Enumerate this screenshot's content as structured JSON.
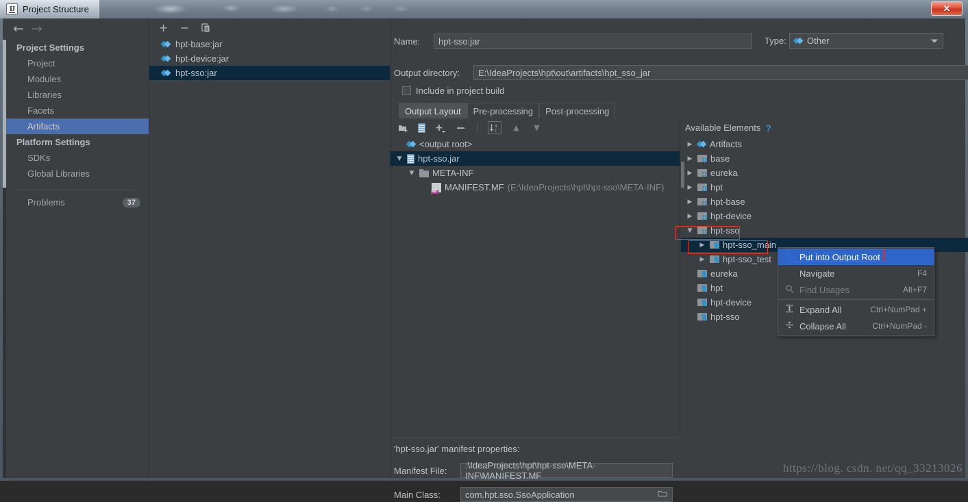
{
  "window": {
    "title": "Project Structure",
    "app_icon": "intellij-idea-icon",
    "close_label": "✕",
    "watermark": "https://blog. csdn. net/qq_33213026"
  },
  "sidebar": {
    "nav_back": "←",
    "nav_forward": "→",
    "groups": [
      {
        "header": "Project Settings",
        "items": [
          {
            "label": "Project",
            "selected": false
          },
          {
            "label": "Modules",
            "selected": false
          },
          {
            "label": "Libraries",
            "selected": false
          },
          {
            "label": "Facets",
            "selected": false
          },
          {
            "label": "Artifacts",
            "selected": true
          }
        ]
      },
      {
        "header": "Platform Settings",
        "items": [
          {
            "label": "SDKs",
            "selected": false
          },
          {
            "label": "Global Libraries",
            "selected": false
          }
        ]
      }
    ],
    "problems": {
      "label": "Problems",
      "count": "37"
    }
  },
  "artifact_list": {
    "toolbar": {
      "add": "+",
      "remove": "−",
      "copy": "copy-icon"
    },
    "items": [
      {
        "label": "hpt-base:jar",
        "selected": false
      },
      {
        "label": "hpt-device:jar",
        "selected": false
      },
      {
        "label": "hpt-sso:jar",
        "selected": true
      }
    ]
  },
  "main": {
    "name_label": "Name:",
    "name_value": "hpt-sso:jar",
    "type_label": "Type:",
    "type_value": "Other",
    "output_dir_label": "Output directory:",
    "output_dir_value": "E:\\IdeaProjects\\hpt\\out\\artifacts\\hpt_sso_jar",
    "include_build_label": "Include in project build",
    "include_build_checked": false,
    "tabs": [
      {
        "label": "Output Layout",
        "active": true
      },
      {
        "label": "Pre-processing",
        "active": false
      },
      {
        "label": "Post-processing",
        "active": false
      }
    ]
  },
  "layout_tree": {
    "toolbar": {
      "add_dir": "add-directory-icon",
      "add_archive": "add-archive-icon",
      "add": "+",
      "remove": "−",
      "sort": "sort-az-icon",
      "move_up": "▲",
      "move_down": "▼"
    },
    "rows": [
      {
        "indent": 0,
        "twisty": "",
        "icon": "output-root-icon",
        "label": "<output root>",
        "sub": "",
        "selected": false
      },
      {
        "indent": 0,
        "twisty": "▼",
        "icon": "archive-icon",
        "label": "hpt-sso.jar",
        "sub": "",
        "selected": true
      },
      {
        "indent": 1,
        "twisty": "▼",
        "icon": "folder-icon",
        "label": "META-INF",
        "sub": "",
        "selected": false
      },
      {
        "indent": 2,
        "twisty": "",
        "icon": "manifest-icon",
        "label": "MANIFEST.MF",
        "sub": "(E:\\IdeaProjects\\hpt\\hpt-sso\\META-INF)",
        "selected": false
      }
    ]
  },
  "available_elements": {
    "header": "Available Elements",
    "help": "?",
    "rows": [
      {
        "indent": 0,
        "twisty": "▶",
        "icon": "artifacts-icon",
        "label": "Artifacts",
        "state": "none"
      },
      {
        "indent": 0,
        "twisty": "▶",
        "icon": "module-icon",
        "label": "base",
        "state": "none"
      },
      {
        "indent": 0,
        "twisty": "▶",
        "icon": "module-icon",
        "label": "eureka",
        "state": "none"
      },
      {
        "indent": 0,
        "twisty": "▶",
        "icon": "module-icon",
        "label": "hpt",
        "state": "none"
      },
      {
        "indent": 0,
        "twisty": "▶",
        "icon": "module-icon",
        "label": "hpt-base",
        "state": "none"
      },
      {
        "indent": 0,
        "twisty": "▶",
        "icon": "module-icon",
        "label": "hpt-device",
        "state": "none"
      },
      {
        "indent": 0,
        "twisty": "▼",
        "icon": "module-icon",
        "label": "hpt-sso",
        "state": "outlined"
      },
      {
        "indent": 1,
        "twisty": "▶",
        "icon": "module-output-icon",
        "label": "hpt-sso_main",
        "state": "selected-outlined"
      },
      {
        "indent": 1,
        "twisty": "▶",
        "icon": "module-output-icon",
        "label": "hpt-sso_test",
        "state": "none"
      },
      {
        "indent": 0,
        "twisty": "",
        "icon": "module-output-icon",
        "label": "eureka",
        "state": "none"
      },
      {
        "indent": 0,
        "twisty": "",
        "icon": "module-output-icon",
        "label": "hpt",
        "state": "none"
      },
      {
        "indent": 0,
        "twisty": "",
        "icon": "module-output-icon",
        "label": "hpt-device",
        "state": "none"
      },
      {
        "indent": 0,
        "twisty": "",
        "icon": "module-output-icon",
        "label": "hpt-sso",
        "state": "none"
      }
    ]
  },
  "context_menu": {
    "items": [
      {
        "label": "Put into Output Root",
        "shortcut": "",
        "icon": "",
        "state": "highlight"
      },
      {
        "label": "Navigate",
        "shortcut": "F4",
        "icon": "",
        "state": "normal"
      },
      {
        "label": "Find Usages",
        "shortcut": "Alt+F7",
        "icon": "search-icon",
        "state": "disabled"
      },
      {
        "label": "Expand All",
        "shortcut": "Ctrl+NumPad +",
        "icon": "expand-all-icon",
        "state": "normal"
      },
      {
        "label": "Collapse All",
        "shortcut": "Ctrl+NumPad -",
        "icon": "collapse-all-icon",
        "state": "normal"
      }
    ]
  },
  "manifest": {
    "title": "'hpt-sso.jar' manifest properties:",
    "file_label": "Manifest File:",
    "file_value": ":\\IdeaProjects\\hpt\\hpt-sso\\META-INF\\MANIFEST.MF",
    "main_class_label": "Main Class:",
    "main_class_value": "com.hpt.sso.SsoApplication"
  },
  "colors": {
    "bg": "#3c3f41",
    "selection_blue": "#4b6eaf",
    "selection_dark": "#0d293e",
    "menu_highlight": "#2f65ca",
    "accent_blue": "#3592c4",
    "annotation_red": "#e8392b",
    "text": "#bcc2c7"
  }
}
